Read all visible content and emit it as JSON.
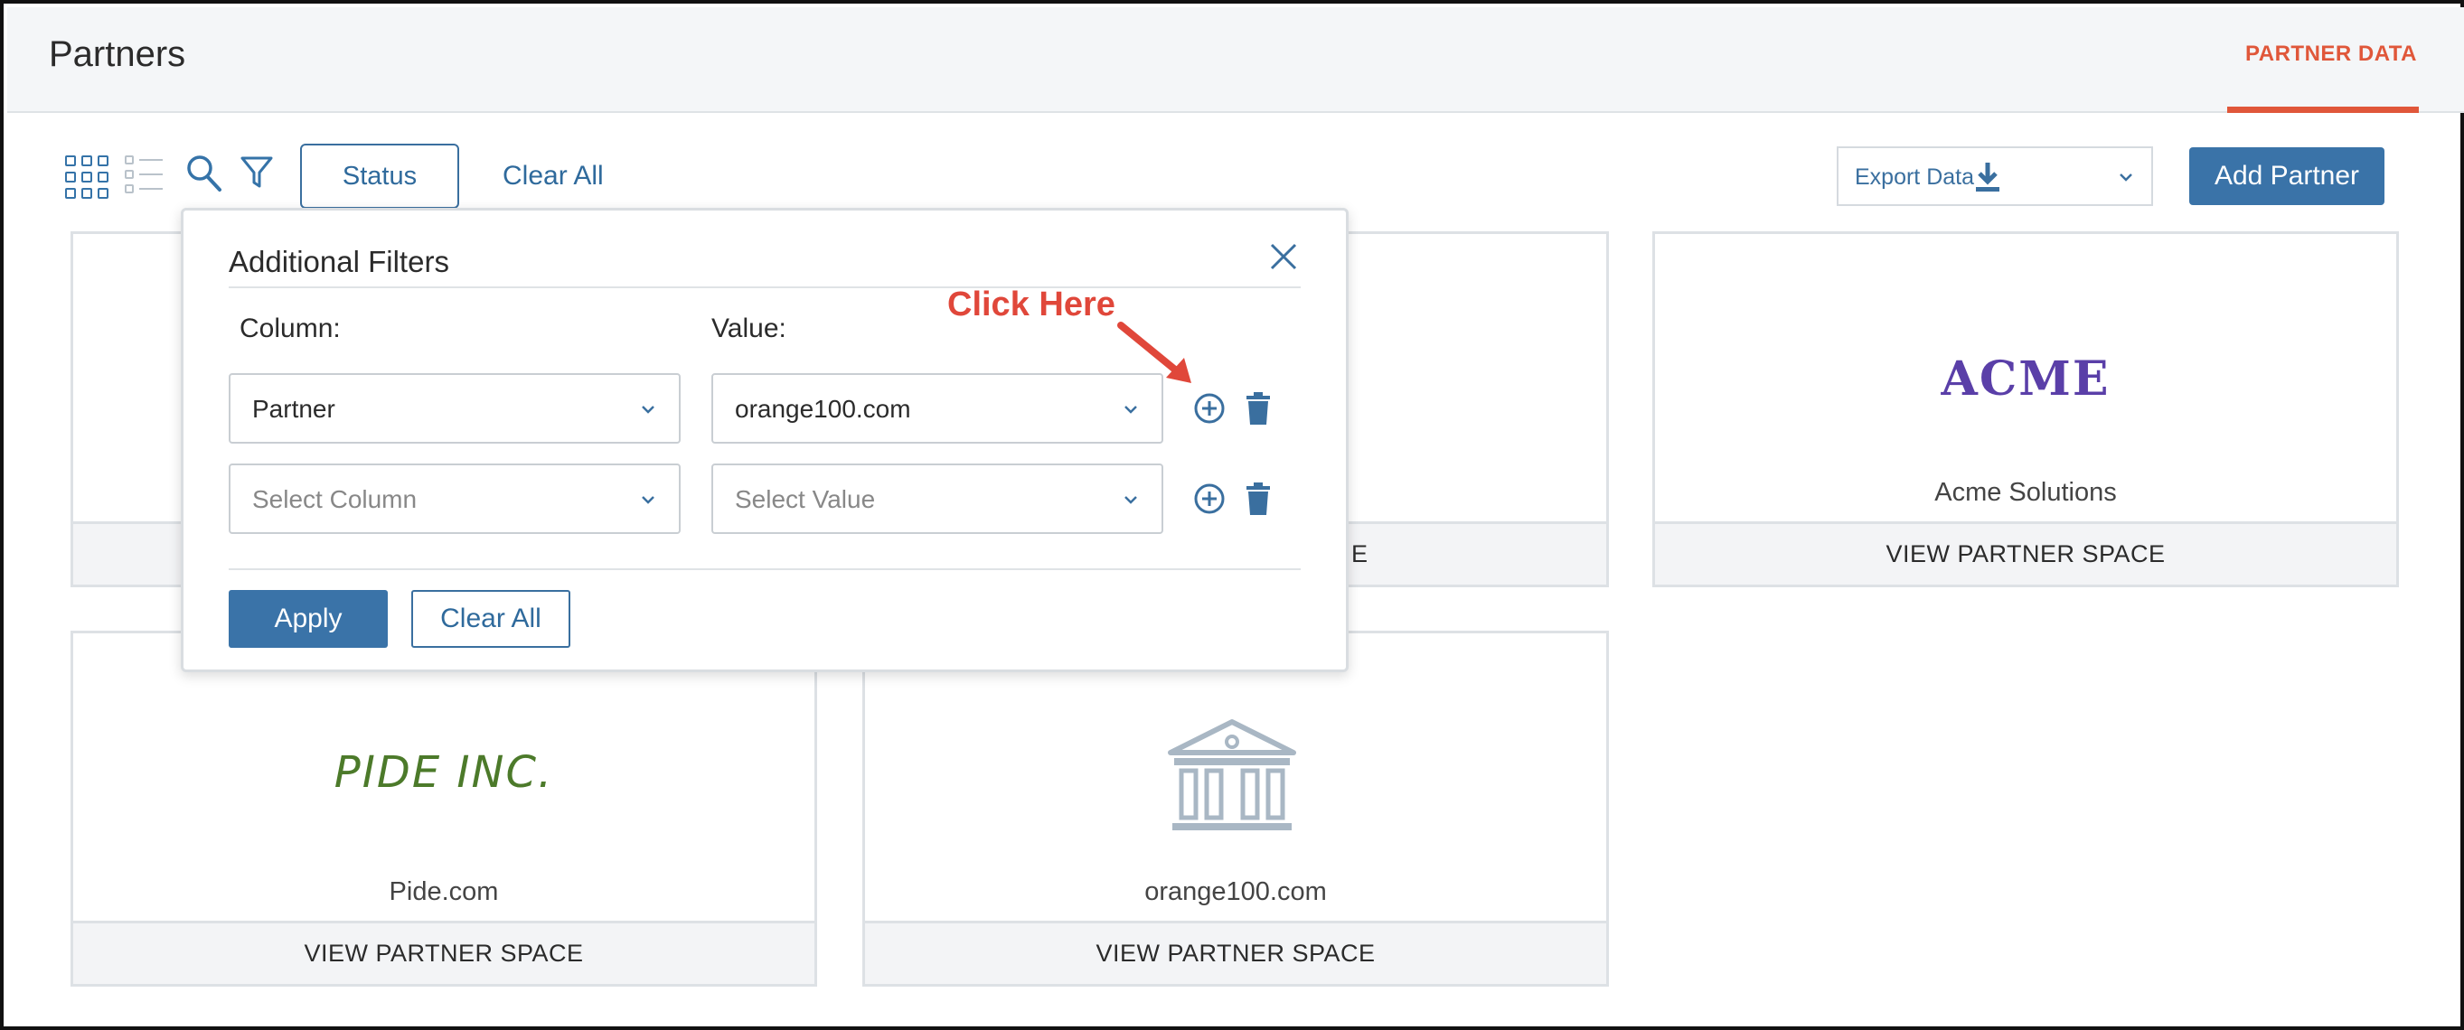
{
  "header": {
    "title": "Partners",
    "tab": "PARTNER DATA"
  },
  "toolbar": {
    "status_label": "Status",
    "clear_all_label": "Clear All",
    "export_label": "Export Data",
    "add_partner_label": "Add Partner"
  },
  "cards": [
    {
      "name": "Acme Solutions",
      "logo_text": "ACME",
      "action": "VIEW PARTNER SPACE"
    },
    {
      "name": "Pide.com",
      "logo_text": "PIDE INC.",
      "action": "VIEW PARTNER SPACE"
    },
    {
      "name": "orange100.com",
      "logo_icon": "bank-icon",
      "action": "VIEW PARTNER SPACE"
    },
    {
      "partial_action": "E"
    }
  ],
  "filters_popup": {
    "title": "Additional Filters",
    "column_label": "Column:",
    "value_label": "Value:",
    "rows": [
      {
        "column": "Partner",
        "value": "orange100.com"
      },
      {
        "column_placeholder": "Select Column",
        "value_placeholder": "Select Value"
      }
    ],
    "apply_label": "Apply",
    "clear_all_label": "Clear All"
  },
  "annotation": {
    "text": "Click Here",
    "color": "#e0473a"
  },
  "colors": {
    "accent": "#e0573a",
    "primary": "#3a73a8"
  }
}
